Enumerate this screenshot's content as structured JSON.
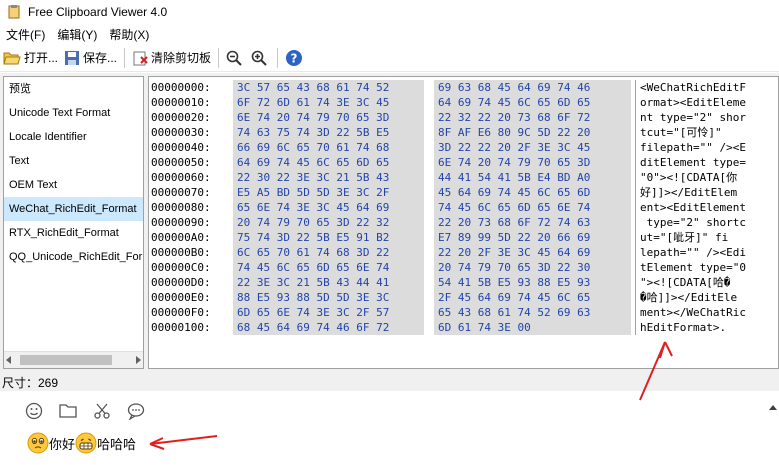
{
  "window": {
    "title": "Free Clipboard Viewer 4.0"
  },
  "menu": {
    "items": [
      "文件(F)",
      "编辑(Y)",
      "帮助(X)"
    ]
  },
  "toolbar": {
    "open_label": "打开...",
    "save_label": "保存...",
    "clear_label": "清除剪切板"
  },
  "sidebar": {
    "items": [
      "预览",
      "Unicode Text Format",
      "Locale Identifier",
      "Text",
      "OEM Text",
      "WeChat_RichEdit_Format",
      "RTX_RichEdit_Format",
      "QQ_Unicode_RichEdit_Format"
    ],
    "selected_index": 5
  },
  "hex": {
    "addresses": [
      "00000000:",
      "00000010:",
      "00000020:",
      "00000030:",
      "00000040:",
      "00000050:",
      "00000060:",
      "00000070:",
      "00000080:",
      "00000090:",
      "000000A0:",
      "000000B0:",
      "000000C0:",
      "000000D0:",
      "000000E0:",
      "000000F0:",
      "00000100:"
    ],
    "left": [
      "3C 57 65 43 68 61 74 52",
      "6F 72 6D 61 74 3E 3C 45",
      "6E 74 20 74 79 70 65 3D",
      "74 63 75 74 3D 22 5B E5",
      "66 69 6C 65 70 61 74 68",
      "64 69 74 45 6C 65 6D 65",
      "22 30 22 3E 3C 21 5B 43",
      "E5 A5 BD 5D 5D 3E 3C 2F",
      "65 6E 74 3E 3C 45 64 69",
      "20 74 79 70 65 3D 22 32",
      "75 74 3D 22 5B E5 91 B2",
      "6C 65 70 61 74 68 3D 22",
      "74 45 6C 65 6D 65 6E 74",
      "22 3E 3C 21 5B 43 44 41",
      "88 E5 93 88 5D 5D 3E 3C",
      "6D 65 6E 74 3E 3C 2F 57",
      "68 45 64 69 74 46 6F 72"
    ],
    "right": [
      "69 63 68 45 64 69 74 46",
      "64 69 74 45 6C 65 6D 65",
      "22 32 22 20 73 68 6F 72",
      "8F AF E6 80 9C 5D 22 20",
      "3D 22 22 20 2F 3E 3C 45",
      "6E 74 20 74 79 70 65 3D",
      "44 41 54 41 5B E4 BD A0",
      "45 64 69 74 45 6C 65 6D",
      "74 45 6C 65 6D 65 6E 74",
      "22 20 73 68 6F 72 74 63",
      "E7 89 99 5D 22 20 66 69",
      "22 20 2F 3E 3C 45 64 69",
      "20 74 79 70 65 3D 22 30",
      "54 41 5B E5 93 88 E5 93",
      "2F 45 64 69 74 45 6C 65",
      "65 43 68 61 74 52 69 63",
      "6D 61 74 3E 00"
    ],
    "ascii": [
      "<WeChatRichEditF",
      "ormat><EditEleme",
      "nt type=\"2\" shor",
      "tcut=\"[可怜]\"",
      "filepath=\"\" /><E",
      "ditElement type=",
      "\"0\"><![CDATA[你",
      "好]]></EditElem",
      "ent><EditElement",
      " type=\"2\" shortc",
      "ut=\"[呲牙]\" fi",
      "lepath=\"\" /><Edi",
      "tElement type=\"0",
      "\"><![CDATA[哈�",
      "�哈]]></EditEle",
      "ment></WeChatRic",
      "hEditFormat>."
    ]
  },
  "status": {
    "size_text": "尺寸：269"
  },
  "chat": {
    "msg_text_1": "你好",
    "msg_text_2": "哈哈哈"
  },
  "colors": {
    "hex_text": "#2244aa",
    "selection": "#cce8ff",
    "arrow": "#e02020"
  }
}
